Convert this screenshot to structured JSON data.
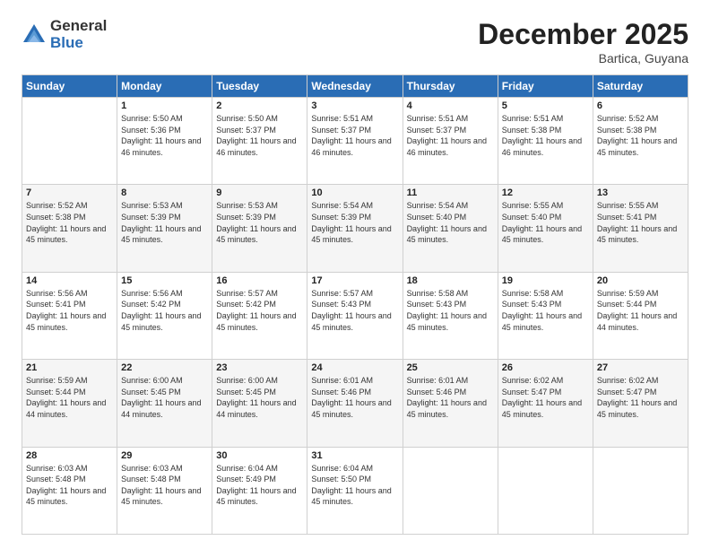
{
  "header": {
    "logo_general": "General",
    "logo_blue": "Blue",
    "month_title": "December 2025",
    "location": "Bartica, Guyana"
  },
  "days_of_week": [
    "Sunday",
    "Monday",
    "Tuesday",
    "Wednesday",
    "Thursday",
    "Friday",
    "Saturday"
  ],
  "weeks": [
    [
      {
        "day": "",
        "sunrise": "",
        "sunset": "",
        "daylight": ""
      },
      {
        "day": "1",
        "sunrise": "Sunrise: 5:50 AM",
        "sunset": "Sunset: 5:36 PM",
        "daylight": "Daylight: 11 hours and 46 minutes."
      },
      {
        "day": "2",
        "sunrise": "Sunrise: 5:50 AM",
        "sunset": "Sunset: 5:37 PM",
        "daylight": "Daylight: 11 hours and 46 minutes."
      },
      {
        "day": "3",
        "sunrise": "Sunrise: 5:51 AM",
        "sunset": "Sunset: 5:37 PM",
        "daylight": "Daylight: 11 hours and 46 minutes."
      },
      {
        "day": "4",
        "sunrise": "Sunrise: 5:51 AM",
        "sunset": "Sunset: 5:37 PM",
        "daylight": "Daylight: 11 hours and 46 minutes."
      },
      {
        "day": "5",
        "sunrise": "Sunrise: 5:51 AM",
        "sunset": "Sunset: 5:38 PM",
        "daylight": "Daylight: 11 hours and 46 minutes."
      },
      {
        "day": "6",
        "sunrise": "Sunrise: 5:52 AM",
        "sunset": "Sunset: 5:38 PM",
        "daylight": "Daylight: 11 hours and 45 minutes."
      }
    ],
    [
      {
        "day": "7",
        "sunrise": "Sunrise: 5:52 AM",
        "sunset": "Sunset: 5:38 PM",
        "daylight": "Daylight: 11 hours and 45 minutes."
      },
      {
        "day": "8",
        "sunrise": "Sunrise: 5:53 AM",
        "sunset": "Sunset: 5:39 PM",
        "daylight": "Daylight: 11 hours and 45 minutes."
      },
      {
        "day": "9",
        "sunrise": "Sunrise: 5:53 AM",
        "sunset": "Sunset: 5:39 PM",
        "daylight": "Daylight: 11 hours and 45 minutes."
      },
      {
        "day": "10",
        "sunrise": "Sunrise: 5:54 AM",
        "sunset": "Sunset: 5:39 PM",
        "daylight": "Daylight: 11 hours and 45 minutes."
      },
      {
        "day": "11",
        "sunrise": "Sunrise: 5:54 AM",
        "sunset": "Sunset: 5:40 PM",
        "daylight": "Daylight: 11 hours and 45 minutes."
      },
      {
        "day": "12",
        "sunrise": "Sunrise: 5:55 AM",
        "sunset": "Sunset: 5:40 PM",
        "daylight": "Daylight: 11 hours and 45 minutes."
      },
      {
        "day": "13",
        "sunrise": "Sunrise: 5:55 AM",
        "sunset": "Sunset: 5:41 PM",
        "daylight": "Daylight: 11 hours and 45 minutes."
      }
    ],
    [
      {
        "day": "14",
        "sunrise": "Sunrise: 5:56 AM",
        "sunset": "Sunset: 5:41 PM",
        "daylight": "Daylight: 11 hours and 45 minutes."
      },
      {
        "day": "15",
        "sunrise": "Sunrise: 5:56 AM",
        "sunset": "Sunset: 5:42 PM",
        "daylight": "Daylight: 11 hours and 45 minutes."
      },
      {
        "day": "16",
        "sunrise": "Sunrise: 5:57 AM",
        "sunset": "Sunset: 5:42 PM",
        "daylight": "Daylight: 11 hours and 45 minutes."
      },
      {
        "day": "17",
        "sunrise": "Sunrise: 5:57 AM",
        "sunset": "Sunset: 5:43 PM",
        "daylight": "Daylight: 11 hours and 45 minutes."
      },
      {
        "day": "18",
        "sunrise": "Sunrise: 5:58 AM",
        "sunset": "Sunset: 5:43 PM",
        "daylight": "Daylight: 11 hours and 45 minutes."
      },
      {
        "day": "19",
        "sunrise": "Sunrise: 5:58 AM",
        "sunset": "Sunset: 5:43 PM",
        "daylight": "Daylight: 11 hours and 45 minutes."
      },
      {
        "day": "20",
        "sunrise": "Sunrise: 5:59 AM",
        "sunset": "Sunset: 5:44 PM",
        "daylight": "Daylight: 11 hours and 44 minutes."
      }
    ],
    [
      {
        "day": "21",
        "sunrise": "Sunrise: 5:59 AM",
        "sunset": "Sunset: 5:44 PM",
        "daylight": "Daylight: 11 hours and 44 minutes."
      },
      {
        "day": "22",
        "sunrise": "Sunrise: 6:00 AM",
        "sunset": "Sunset: 5:45 PM",
        "daylight": "Daylight: 11 hours and 44 minutes."
      },
      {
        "day": "23",
        "sunrise": "Sunrise: 6:00 AM",
        "sunset": "Sunset: 5:45 PM",
        "daylight": "Daylight: 11 hours and 44 minutes."
      },
      {
        "day": "24",
        "sunrise": "Sunrise: 6:01 AM",
        "sunset": "Sunset: 5:46 PM",
        "daylight": "Daylight: 11 hours and 45 minutes."
      },
      {
        "day": "25",
        "sunrise": "Sunrise: 6:01 AM",
        "sunset": "Sunset: 5:46 PM",
        "daylight": "Daylight: 11 hours and 45 minutes."
      },
      {
        "day": "26",
        "sunrise": "Sunrise: 6:02 AM",
        "sunset": "Sunset: 5:47 PM",
        "daylight": "Daylight: 11 hours and 45 minutes."
      },
      {
        "day": "27",
        "sunrise": "Sunrise: 6:02 AM",
        "sunset": "Sunset: 5:47 PM",
        "daylight": "Daylight: 11 hours and 45 minutes."
      }
    ],
    [
      {
        "day": "28",
        "sunrise": "Sunrise: 6:03 AM",
        "sunset": "Sunset: 5:48 PM",
        "daylight": "Daylight: 11 hours and 45 minutes."
      },
      {
        "day": "29",
        "sunrise": "Sunrise: 6:03 AM",
        "sunset": "Sunset: 5:48 PM",
        "daylight": "Daylight: 11 hours and 45 minutes."
      },
      {
        "day": "30",
        "sunrise": "Sunrise: 6:04 AM",
        "sunset": "Sunset: 5:49 PM",
        "daylight": "Daylight: 11 hours and 45 minutes."
      },
      {
        "day": "31",
        "sunrise": "Sunrise: 6:04 AM",
        "sunset": "Sunset: 5:50 PM",
        "daylight": "Daylight: 11 hours and 45 minutes."
      },
      {
        "day": "",
        "sunrise": "",
        "sunset": "",
        "daylight": ""
      },
      {
        "day": "",
        "sunrise": "",
        "sunset": "",
        "daylight": ""
      },
      {
        "day": "",
        "sunrise": "",
        "sunset": "",
        "daylight": ""
      }
    ]
  ]
}
